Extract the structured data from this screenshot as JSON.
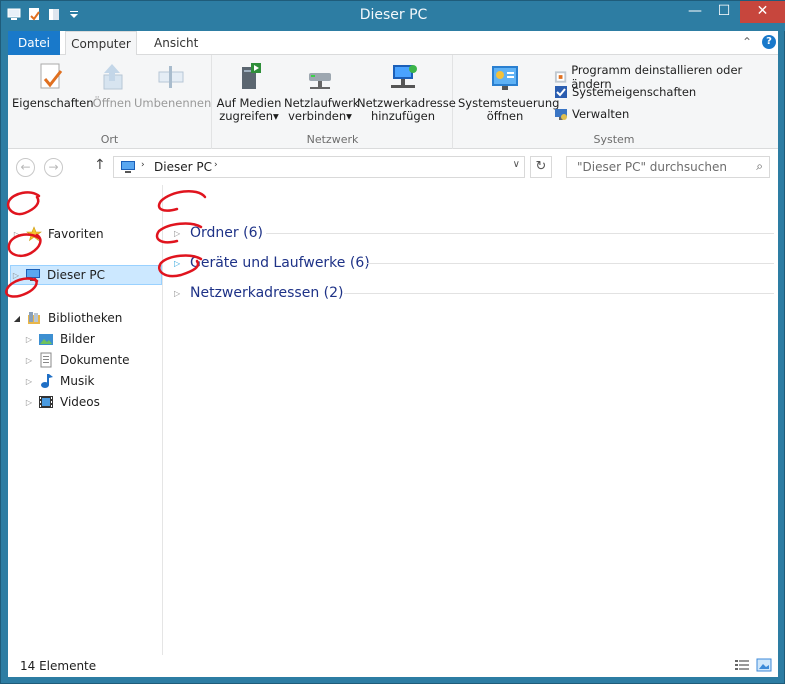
{
  "window": {
    "title": "Dieser PC",
    "minimize": "—",
    "maximize": "☐",
    "close": "✕"
  },
  "ribbon_tabs": {
    "file": "Datei",
    "computer": "Computer",
    "view": "Ansicht",
    "collapse": "⌃",
    "help": "?"
  },
  "ribbon": {
    "ort": {
      "label": "Ort",
      "properties": "Eigenschaften",
      "open": "Öffnen",
      "rename": "Umbenennen"
    },
    "netzwerk": {
      "label": "Netzwerk",
      "media_line1": "Auf Medien",
      "media_line2": "zugreifen",
      "netdrive_line1": "Netzlaufwerk",
      "netdrive_line2": "verbinden",
      "netaddr_line1": "Netzwerkadresse",
      "netaddr_line2": "hinzufügen",
      "dropdown": "▾"
    },
    "system": {
      "label": "System",
      "control_line1": "Systemsteuerung",
      "control_line2": "öffnen",
      "uninstall": "Programm deinstallieren oder ändern",
      "sysprops": "Systemeigenschaften",
      "manage": "Verwalten"
    }
  },
  "address": {
    "back": "←",
    "forward": "→",
    "up": "↑",
    "crumb": "Dieser PC",
    "chev": "›",
    "dropdown": "∨",
    "refresh": "↻",
    "search_placeholder": "\"Dieser PC\" durchsuchen",
    "search_icon": "⌕"
  },
  "nav": {
    "favorites": "Favoriten",
    "this_pc": "Dieser PC",
    "libraries": "Bibliotheken",
    "pictures": "Bilder",
    "documents": "Dokumente",
    "music": "Musik",
    "videos": "Videos",
    "tw_closed": "▷",
    "tw_open": "◢"
  },
  "groups": [
    {
      "label": "Ordner (6)"
    },
    {
      "label": "Geräte und Laufwerke (6)"
    },
    {
      "label": "Netzwerkadressen (2)"
    }
  ],
  "status": {
    "count": "14 Elemente"
  },
  "colors": {
    "accent": "#1979ca",
    "titlebar": "#2d7da3",
    "close": "#c7463d",
    "annotation": "#e0141e",
    "group_text": "#1e3287"
  }
}
